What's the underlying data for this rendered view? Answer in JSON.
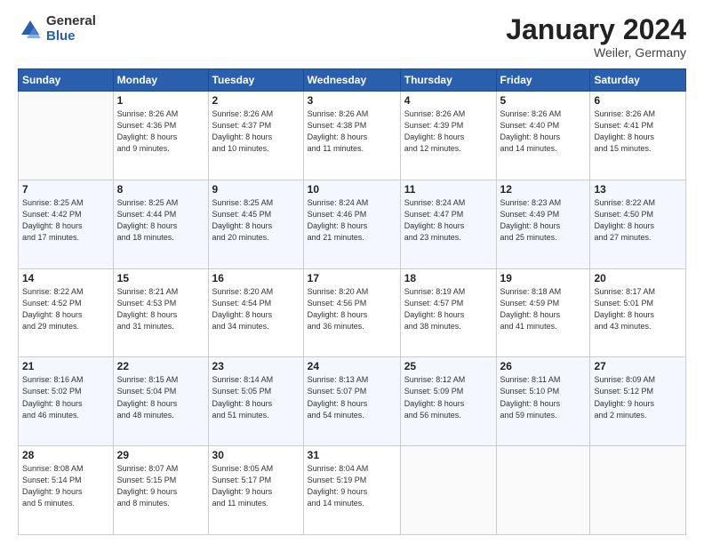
{
  "logo": {
    "general": "General",
    "blue": "Blue"
  },
  "header": {
    "month": "January 2024",
    "location": "Weiler, Germany"
  },
  "weekdays": [
    "Sunday",
    "Monday",
    "Tuesday",
    "Wednesday",
    "Thursday",
    "Friday",
    "Saturday"
  ],
  "weeks": [
    [
      {
        "day": "",
        "info": ""
      },
      {
        "day": "1",
        "info": "Sunrise: 8:26 AM\nSunset: 4:36 PM\nDaylight: 8 hours\nand 9 minutes."
      },
      {
        "day": "2",
        "info": "Sunrise: 8:26 AM\nSunset: 4:37 PM\nDaylight: 8 hours\nand 10 minutes."
      },
      {
        "day": "3",
        "info": "Sunrise: 8:26 AM\nSunset: 4:38 PM\nDaylight: 8 hours\nand 11 minutes."
      },
      {
        "day": "4",
        "info": "Sunrise: 8:26 AM\nSunset: 4:39 PM\nDaylight: 8 hours\nand 12 minutes."
      },
      {
        "day": "5",
        "info": "Sunrise: 8:26 AM\nSunset: 4:40 PM\nDaylight: 8 hours\nand 14 minutes."
      },
      {
        "day": "6",
        "info": "Sunrise: 8:26 AM\nSunset: 4:41 PM\nDaylight: 8 hours\nand 15 minutes."
      }
    ],
    [
      {
        "day": "7",
        "info": "Sunrise: 8:25 AM\nSunset: 4:42 PM\nDaylight: 8 hours\nand 17 minutes."
      },
      {
        "day": "8",
        "info": "Sunrise: 8:25 AM\nSunset: 4:44 PM\nDaylight: 8 hours\nand 18 minutes."
      },
      {
        "day": "9",
        "info": "Sunrise: 8:25 AM\nSunset: 4:45 PM\nDaylight: 8 hours\nand 20 minutes."
      },
      {
        "day": "10",
        "info": "Sunrise: 8:24 AM\nSunset: 4:46 PM\nDaylight: 8 hours\nand 21 minutes."
      },
      {
        "day": "11",
        "info": "Sunrise: 8:24 AM\nSunset: 4:47 PM\nDaylight: 8 hours\nand 23 minutes."
      },
      {
        "day": "12",
        "info": "Sunrise: 8:23 AM\nSunset: 4:49 PM\nDaylight: 8 hours\nand 25 minutes."
      },
      {
        "day": "13",
        "info": "Sunrise: 8:22 AM\nSunset: 4:50 PM\nDaylight: 8 hours\nand 27 minutes."
      }
    ],
    [
      {
        "day": "14",
        "info": "Sunrise: 8:22 AM\nSunset: 4:52 PM\nDaylight: 8 hours\nand 29 minutes."
      },
      {
        "day": "15",
        "info": "Sunrise: 8:21 AM\nSunset: 4:53 PM\nDaylight: 8 hours\nand 31 minutes."
      },
      {
        "day": "16",
        "info": "Sunrise: 8:20 AM\nSunset: 4:54 PM\nDaylight: 8 hours\nand 34 minutes."
      },
      {
        "day": "17",
        "info": "Sunrise: 8:20 AM\nSunset: 4:56 PM\nDaylight: 8 hours\nand 36 minutes."
      },
      {
        "day": "18",
        "info": "Sunrise: 8:19 AM\nSunset: 4:57 PM\nDaylight: 8 hours\nand 38 minutes."
      },
      {
        "day": "19",
        "info": "Sunrise: 8:18 AM\nSunset: 4:59 PM\nDaylight: 8 hours\nand 41 minutes."
      },
      {
        "day": "20",
        "info": "Sunrise: 8:17 AM\nSunset: 5:01 PM\nDaylight: 8 hours\nand 43 minutes."
      }
    ],
    [
      {
        "day": "21",
        "info": "Sunrise: 8:16 AM\nSunset: 5:02 PM\nDaylight: 8 hours\nand 46 minutes."
      },
      {
        "day": "22",
        "info": "Sunrise: 8:15 AM\nSunset: 5:04 PM\nDaylight: 8 hours\nand 48 minutes."
      },
      {
        "day": "23",
        "info": "Sunrise: 8:14 AM\nSunset: 5:05 PM\nDaylight: 8 hours\nand 51 minutes."
      },
      {
        "day": "24",
        "info": "Sunrise: 8:13 AM\nSunset: 5:07 PM\nDaylight: 8 hours\nand 54 minutes."
      },
      {
        "day": "25",
        "info": "Sunrise: 8:12 AM\nSunset: 5:09 PM\nDaylight: 8 hours\nand 56 minutes."
      },
      {
        "day": "26",
        "info": "Sunrise: 8:11 AM\nSunset: 5:10 PM\nDaylight: 8 hours\nand 59 minutes."
      },
      {
        "day": "27",
        "info": "Sunrise: 8:09 AM\nSunset: 5:12 PM\nDaylight: 9 hours\nand 2 minutes."
      }
    ],
    [
      {
        "day": "28",
        "info": "Sunrise: 8:08 AM\nSunset: 5:14 PM\nDaylight: 9 hours\nand 5 minutes."
      },
      {
        "day": "29",
        "info": "Sunrise: 8:07 AM\nSunset: 5:15 PM\nDaylight: 9 hours\nand 8 minutes."
      },
      {
        "day": "30",
        "info": "Sunrise: 8:05 AM\nSunset: 5:17 PM\nDaylight: 9 hours\nand 11 minutes."
      },
      {
        "day": "31",
        "info": "Sunrise: 8:04 AM\nSunset: 5:19 PM\nDaylight: 9 hours\nand 14 minutes."
      },
      {
        "day": "",
        "info": ""
      },
      {
        "day": "",
        "info": ""
      },
      {
        "day": "",
        "info": ""
      }
    ]
  ]
}
